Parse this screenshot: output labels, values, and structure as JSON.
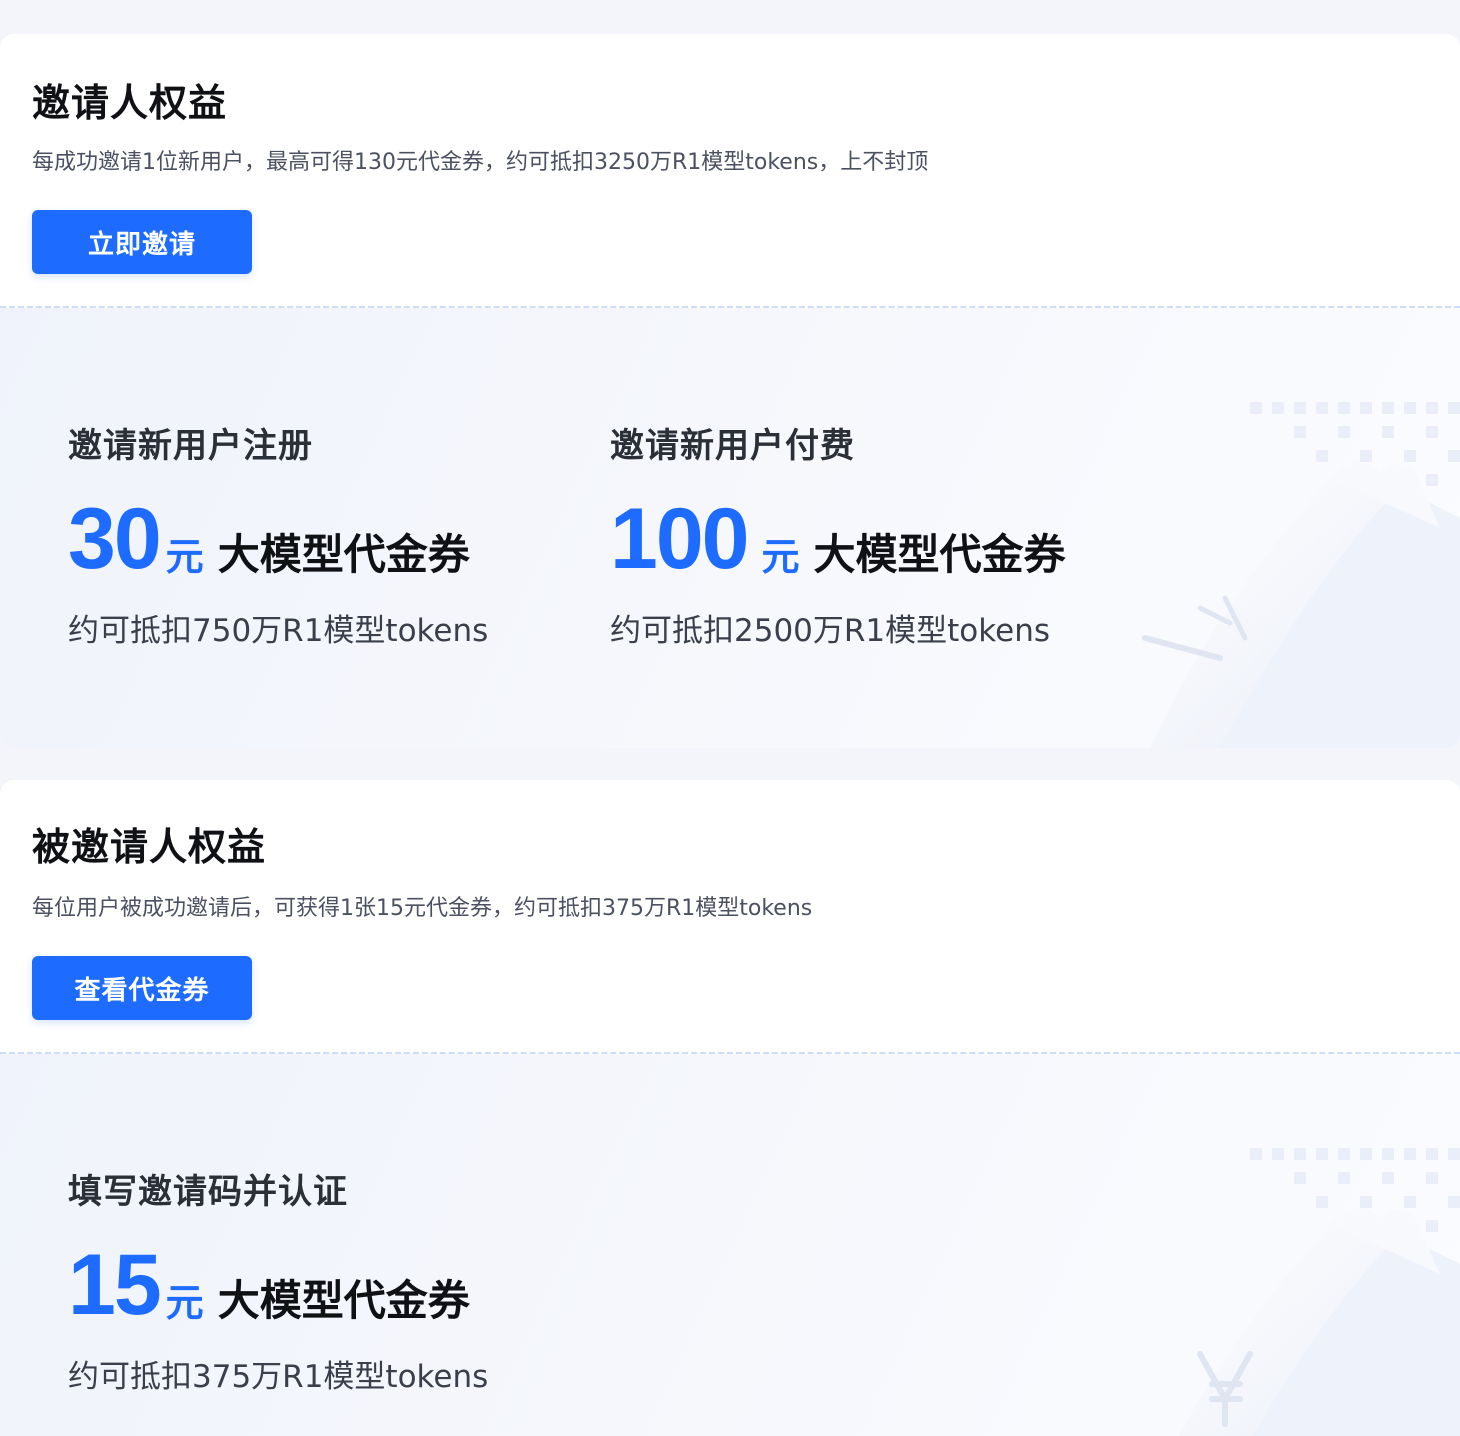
{
  "inviter": {
    "title": "邀请人权益",
    "desc": "每成功邀请1位新用户，最高可得130元代金券，约可抵扣3250万R1模型tokens，上不封顶",
    "button_label": "立即邀请",
    "rewards": [
      {
        "label": "邀请新用户注册",
        "amount": "30",
        "unit": "元",
        "coupon": "大模型代金券",
        "sub": "约可抵扣750万R1模型tokens"
      },
      {
        "label": "邀请新用户付费",
        "amount": "100",
        "unit": "元",
        "coupon": "大模型代金券",
        "sub": "约可抵扣2500万R1模型tokens"
      }
    ]
  },
  "invitee": {
    "title": "被邀请人权益",
    "desc": "每位用户被成功邀请后，可获得1张15元代金券，约可抵扣375万R1模型tokens",
    "button_label": "查看代金券",
    "rewards": [
      {
        "label": "填写邀请码并认证",
        "amount": "15",
        "unit": "元",
        "coupon": "大模型代金券",
        "sub": "约可抵扣375万R1模型tokens"
      }
    ]
  },
  "colors": {
    "accent": "#1e6cff",
    "background": "#f3f5fb",
    "card": "#ffffff",
    "dashed_divider": "#cfdcf7"
  }
}
